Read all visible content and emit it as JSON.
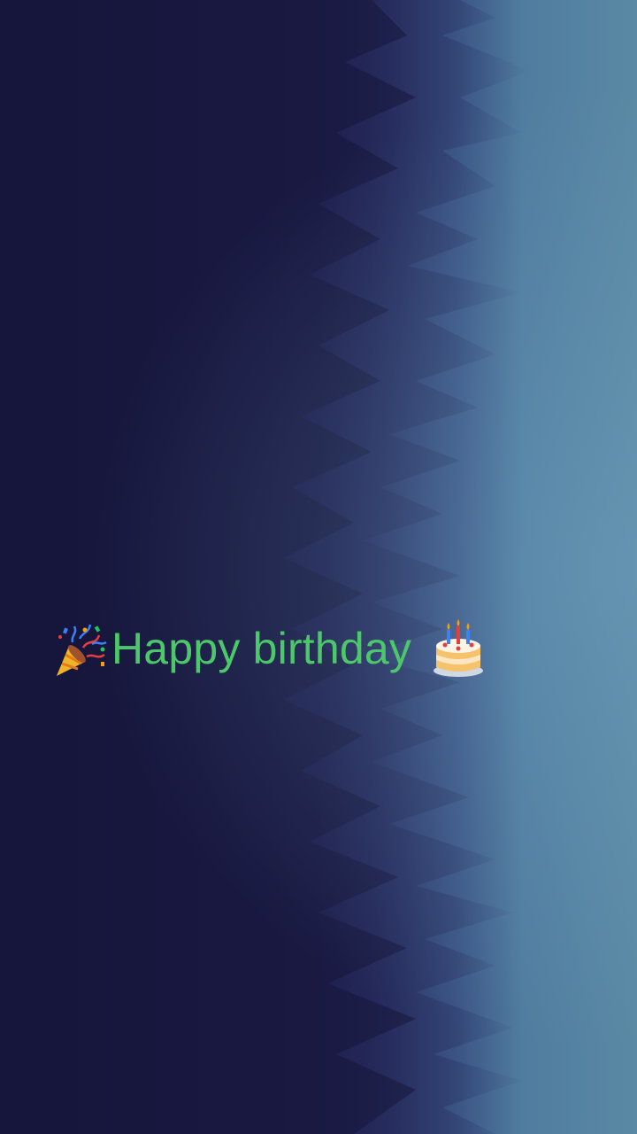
{
  "background": {
    "description_colors": {
      "dark": "#1a1843",
      "mid": "#2a2f63",
      "fog": "#5a89a4"
    }
  },
  "greeting": {
    "leading_icon": "party-popper-icon",
    "text": "Happy birthday",
    "trailing_icon": "birthday-cake-icon",
    "text_color": "#4cc86a"
  }
}
